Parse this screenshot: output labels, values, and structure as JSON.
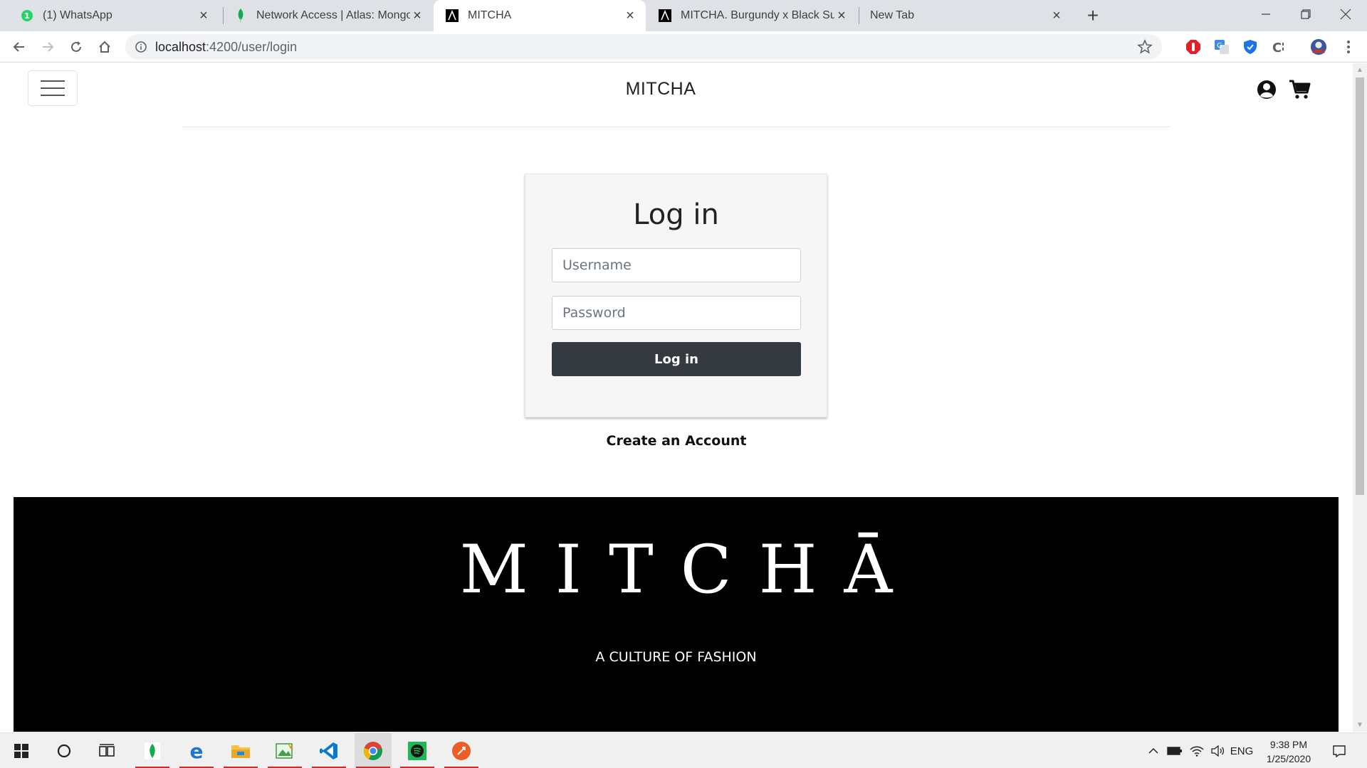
{
  "browser": {
    "tabs": [
      {
        "title": "(1) WhatsApp",
        "icon": "whatsapp-icon",
        "active": false
      },
      {
        "title": "Network Access | Atlas: MongoDB",
        "icon": "mongodb-leaf-icon",
        "active": false
      },
      {
        "title": "MITCHA",
        "icon": "mitcha-icon",
        "active": true
      },
      {
        "title": "MITCHA. Burgundy x Black Suede",
        "icon": "mitcha-icon",
        "active": false
      },
      {
        "title": "New Tab",
        "icon": "",
        "active": false
      }
    ],
    "new_tab_label": "+",
    "url_host": "localhost",
    "url_path": ":4200/user/login"
  },
  "header": {
    "brand": "MITCHA"
  },
  "login": {
    "title": "Log in",
    "username_placeholder": "Username",
    "password_placeholder": "Password",
    "submit_label": "Log in",
    "create_account": "Create an Account"
  },
  "footer": {
    "logo": "MITCHĀ",
    "tagline": "A CULTURE OF FASHION"
  },
  "taskbar": {
    "apps": [
      "mongodb-compass-icon",
      "edge-icon",
      "file-explorer-icon",
      "photos-icon",
      "vscode-icon",
      "chrome-icon",
      "spotify-icon",
      "postman-icon"
    ],
    "language": "ENG",
    "time": "9:38 PM",
    "date": "1/25/2020"
  },
  "colors": {
    "button_dark": "#343a40",
    "footer_bg": "#000000",
    "card_bg": "#f6f6f6",
    "tabstrip_bg": "#dee1e6",
    "taskbar_underline": "#d0282b"
  }
}
